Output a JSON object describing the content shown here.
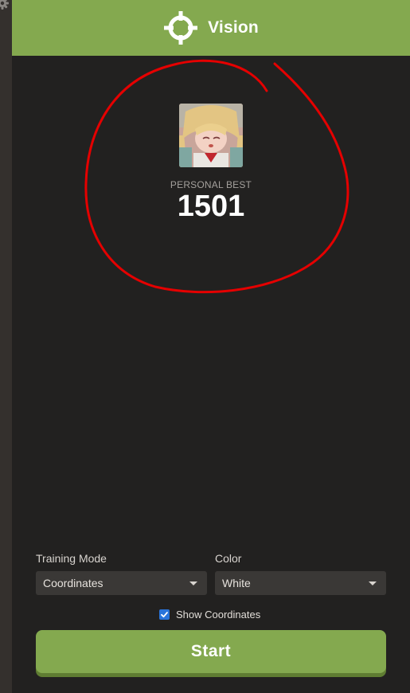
{
  "app": {
    "title": "Vision",
    "logo_icon": "crosshair-icon",
    "accent_color": "#84a94f"
  },
  "profile": {
    "avatar_icon": "profile-avatar-image",
    "personal_best_label": "PERSONAL BEST",
    "personal_best_value": "1501"
  },
  "annotation": {
    "type": "red-freehand-circle",
    "color": "#e50000"
  },
  "settings": {
    "training_mode": {
      "label": "Training Mode",
      "selected": "Coordinates"
    },
    "color": {
      "label": "Color",
      "selected": "White"
    },
    "show_coordinates": {
      "label": "Show Coordinates",
      "checked": true
    }
  },
  "actions": {
    "start_label": "Start"
  }
}
